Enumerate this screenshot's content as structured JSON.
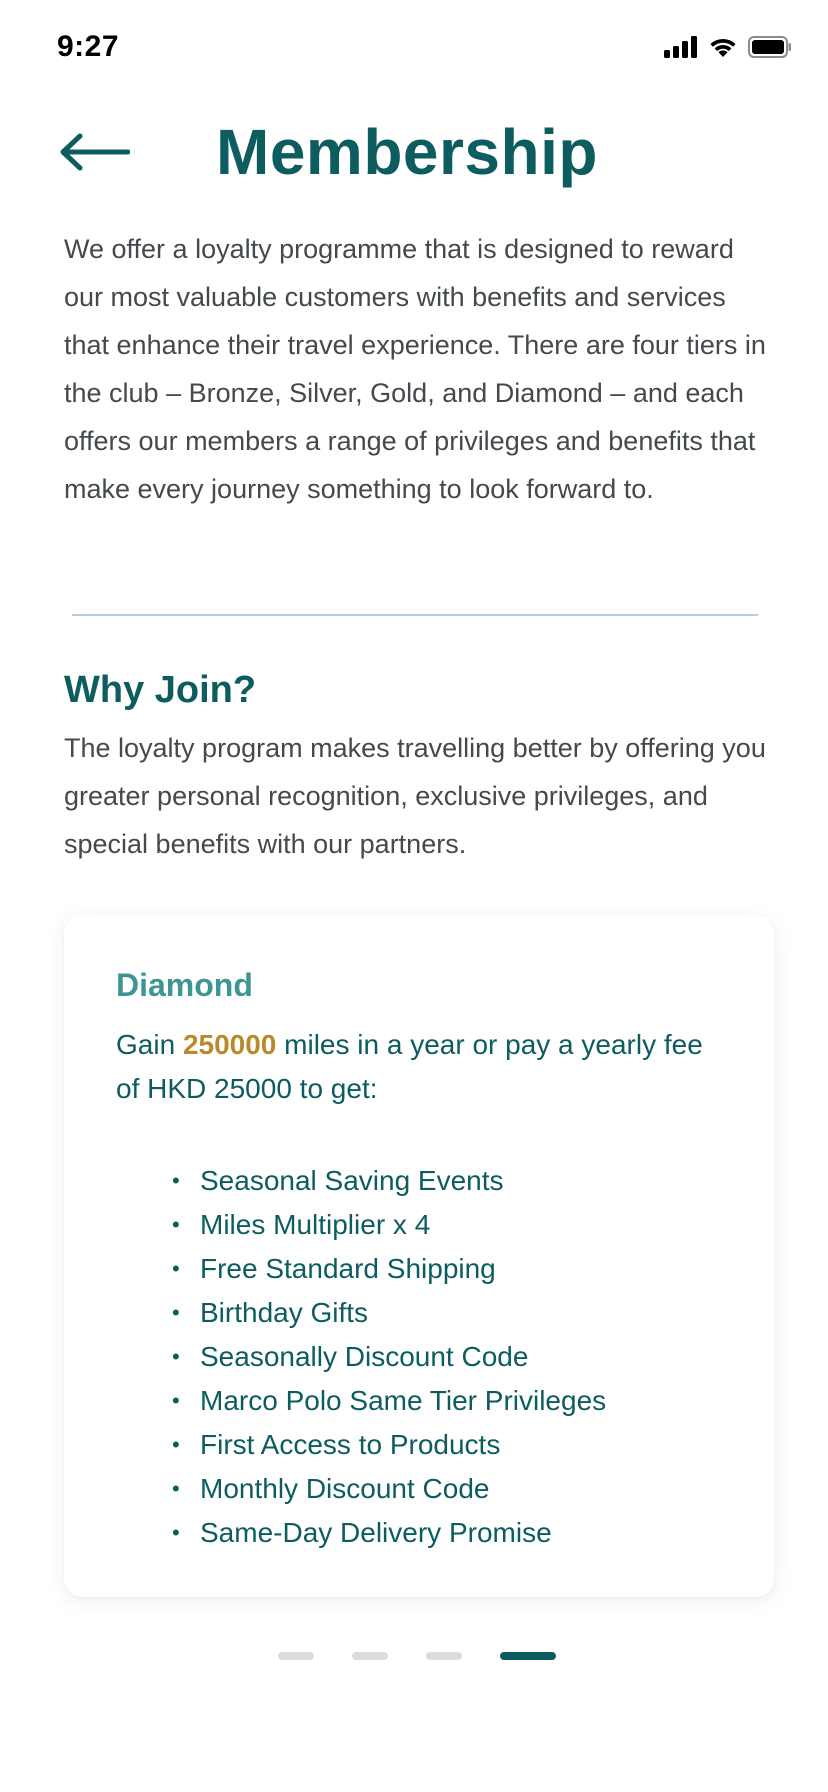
{
  "status_bar": {
    "time": "9:27",
    "icons": [
      "signal-icon",
      "wifi-icon",
      "battery-icon"
    ]
  },
  "header": {
    "back_icon": "arrow-left-icon",
    "title": "Membership"
  },
  "intro": {
    "text": "We offer a loyalty programme that is designed to reward our most valuable customers with benefits and services that enhance their travel experience. There are four tiers in the club – Bronze, Silver, Gold, and Diamond – and each offers our members a range of privileges and benefits that make every journey something to look forward to."
  },
  "why_join": {
    "title": "Why Join?",
    "text": "The loyalty program makes travelling better by offering you greater personal recognition, exclusive privileges, and special benefits with our partners."
  },
  "tier_card": {
    "name": "Diamond",
    "desc_prefix": "Gain ",
    "miles": "250000",
    "desc_suffix": " miles in a year or pay a yearly fee of HKD 25000 to get:",
    "benefits": [
      "Seasonal Saving Events",
      "Miles Multiplier x 4",
      "Free Standard Shipping",
      "Birthday Gifts",
      "Seasonally Discount Code",
      "Marco Polo Same Tier Privileges",
      "First Access to Products",
      "Monthly Discount Code",
      "Same-Day Delivery Promise"
    ]
  },
  "pager": {
    "page_count": 4,
    "active_index": 3
  },
  "colors": {
    "primary": "#0d5c5f",
    "tier_name": "#3e9693",
    "highlight": "#b98a2c",
    "divider": "#b4cfdf",
    "inactive_dot": "#dcdcdc"
  }
}
